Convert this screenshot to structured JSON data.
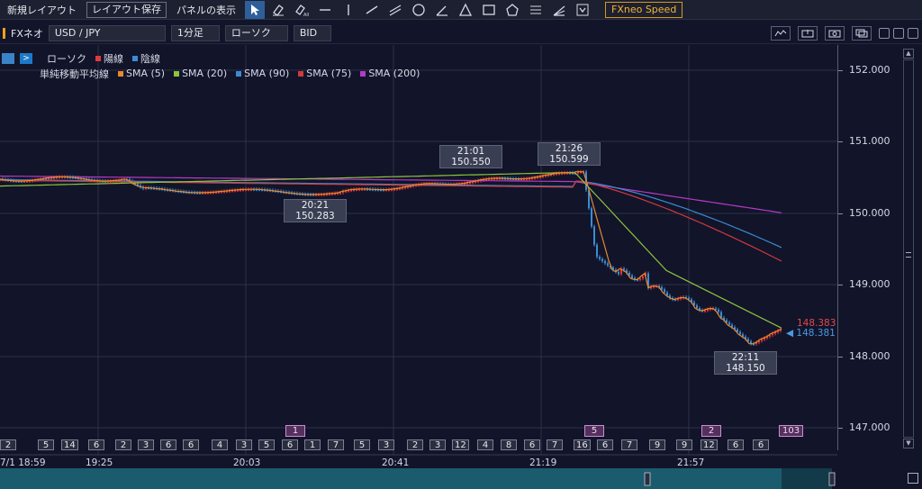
{
  "toolbar": {
    "new_layout": "新規レイアウト",
    "save_layout": "レイアウト保存",
    "panel_display": "パネルの表示",
    "speed": "FXneo Speed",
    "tools": [
      "cursor-icon",
      "eraser-icon",
      "eraser-all-icon",
      "horizontal-line-icon",
      "vertical-line-icon",
      "trend-line-icon",
      "parallel-line-icon",
      "circle-icon",
      "angle-icon",
      "triangle-icon",
      "rectangle-icon",
      "pentagon-icon",
      "fibonacci-icon",
      "fan-icon",
      "dropdown-icon"
    ]
  },
  "symbolbar": {
    "app_name": "FXネオ",
    "pair": "USD / JPY",
    "timeframe": "1分足",
    "chart_type": "ローソク",
    "price_side": "BID"
  },
  "legend": {
    "candle": "ローソク",
    "yang": "陽線",
    "yin": "陰線",
    "sma_label": "単純移動平均線",
    "sma": [
      {
        "name": "SMA (5)",
        "color": "#e88a2a"
      },
      {
        "name": "SMA (20)",
        "color": "#8cc43c"
      },
      {
        "name": "SMA (90)",
        "color": "#3a8cd0"
      },
      {
        "name": "SMA (75)",
        "color": "#d23a3a"
      },
      {
        "name": "SMA (200)",
        "color": "#b53ac4"
      }
    ],
    "yang_color": "#e23a3a",
    "yin_color": "#3a8cd6"
  },
  "price_labels": [
    {
      "time": "20:21",
      "price": "150.283"
    },
    {
      "time": "21:01",
      "price": "150.550"
    },
    {
      "time": "21:26",
      "price": "150.599"
    },
    {
      "time": "22:11",
      "price": "148.150"
    }
  ],
  "last_prices": {
    "ask": "148.383",
    "bid": "148.381"
  },
  "y_ticks": [
    "152.000",
    "151.000",
    "150.000",
    "149.000",
    "148.000",
    "147.000"
  ],
  "x_ticks": [
    "7/1 18:59",
    "19:25",
    "20:03",
    "20:41",
    "21:19",
    "21:57"
  ],
  "count_badges": [
    "2",
    "5",
    "14",
    "6",
    "2",
    "3",
    "6",
    "6",
    "4",
    "3",
    "5",
    "6",
    "1",
    "7",
    "5",
    "3",
    "2",
    "3",
    "12",
    "4",
    "8",
    "6",
    "7",
    "16",
    "6",
    "7",
    "9",
    "9",
    "12",
    "6",
    "6"
  ],
  "purple_badges": [
    "1",
    "5",
    "2",
    "103"
  ]
}
